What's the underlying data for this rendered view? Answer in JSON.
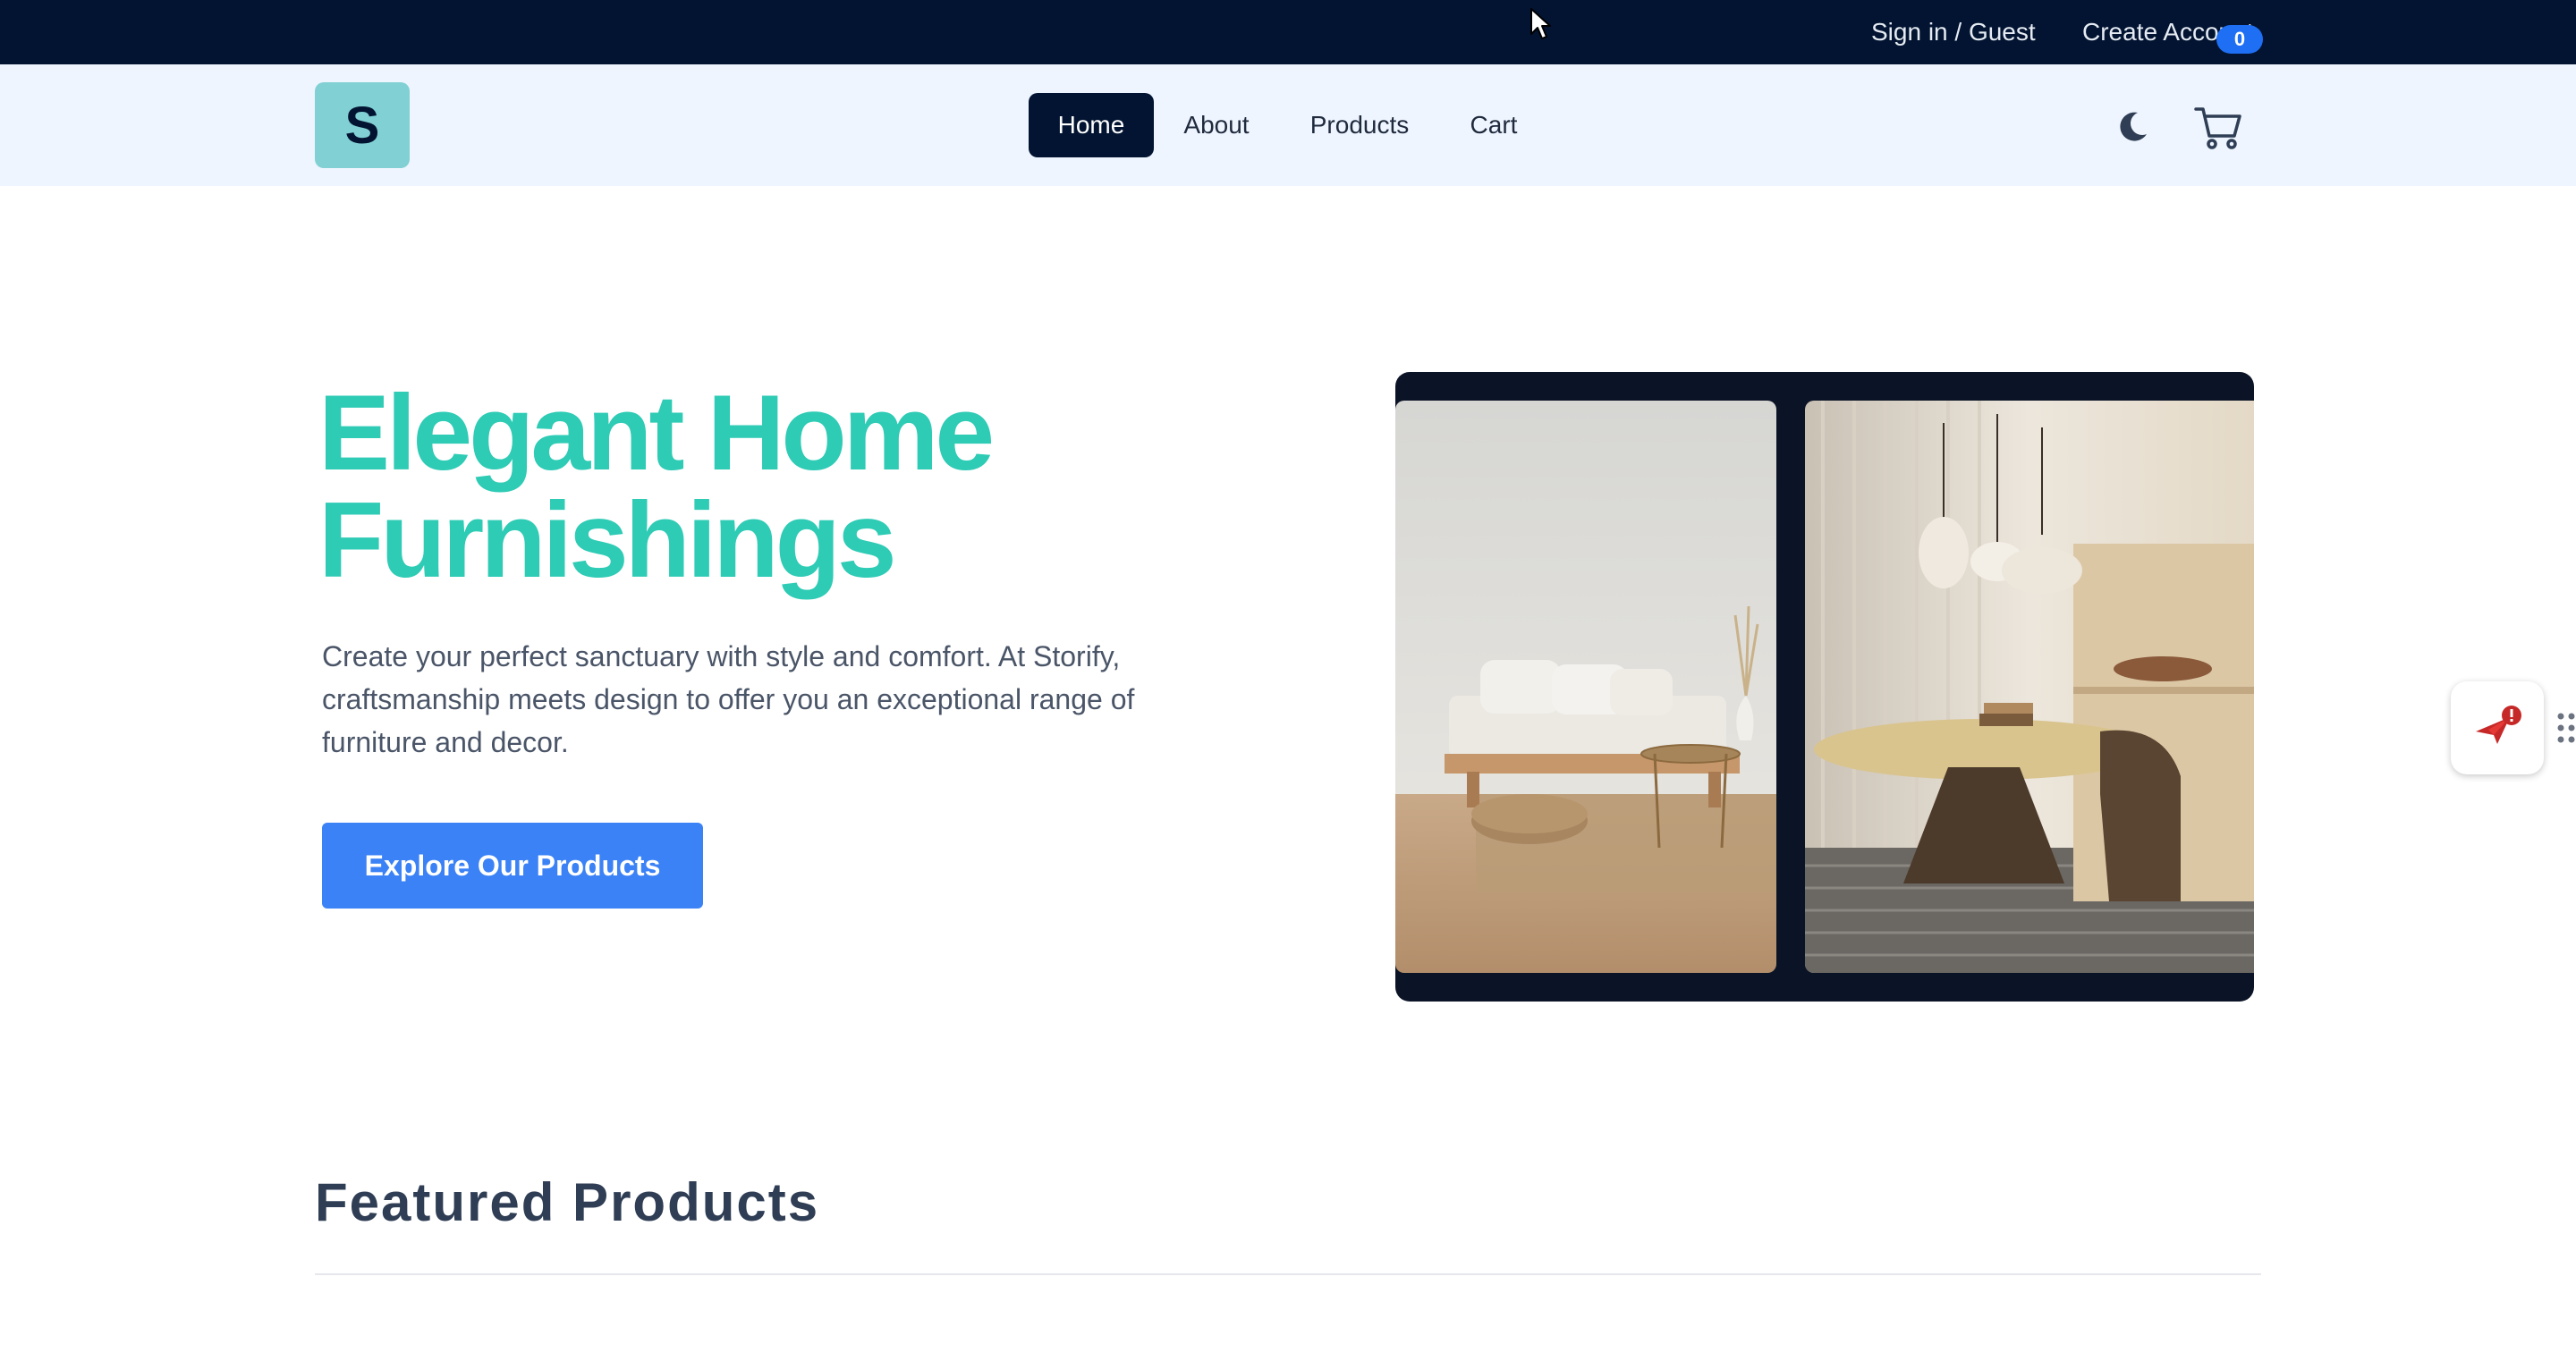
{
  "topbar": {
    "signin_label": "Sign in / Guest",
    "create_account_label": "Create Account"
  },
  "navbar": {
    "logo_letter": "S",
    "links": [
      {
        "label": "Home",
        "active": true
      },
      {
        "label": "About",
        "active": false
      },
      {
        "label": "Products",
        "active": false
      },
      {
        "label": "Cart",
        "active": false
      }
    ],
    "theme_toggle_icon": "moon-icon",
    "cart_icon": "cart-icon",
    "cart_count": "0"
  },
  "hero": {
    "title_line1": "Elegant Home",
    "title_line2": "Furnishings",
    "description": "Create your perfect sanctuary with style and comfort. At Storify, craftsmanship meets design to offer you an exceptional range of furniture and decor.",
    "cta_label": "Explore Our Products",
    "images": [
      "living-room-sofa-photo",
      "dining-room-table-photo"
    ]
  },
  "widget": {
    "icon": "paper-plane-alert-icon",
    "grip_icon": "drag-grip-icon"
  },
  "featured": {
    "heading": "Featured Products"
  },
  "colors": {
    "topbar_bg": "#021431",
    "navbar_bg": "#eef5ff",
    "logo_bg": "#80d0d4",
    "accent_teal": "#2ecbb5",
    "cta_blue": "#3b82f6",
    "badge_blue": "#1e6ff4"
  }
}
